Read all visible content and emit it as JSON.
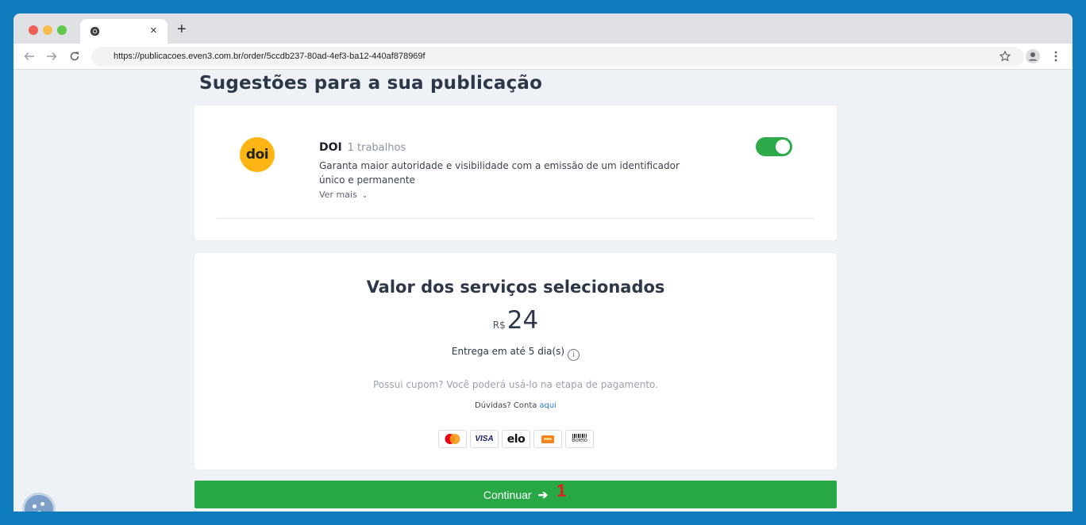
{
  "browser": {
    "tab_close": "×",
    "new_tab": "+",
    "url": "https://publicacoes.even3.com.br/order/5ccdb237-80ad-4ef3-ba12-440af878969f"
  },
  "page": {
    "heading": "Sugestões para a sua publicação"
  },
  "suggestion": {
    "logo_text": "doi",
    "title": "DOI",
    "count": "1 trabalhos",
    "description": "Garanta maior autoridade e visibilidade com a emissão de um identificador único e permanente",
    "see_more": "Ver mais",
    "toggle_on": true,
    "toggle_color": "#2eaa4a"
  },
  "summary": {
    "title": "Valor dos serviços selecionados",
    "currency": "R$",
    "price": "24",
    "delivery": "Entrega em até 5 dia(s)",
    "coupon_note": "Possui cupom? Você poderá usá-lo na etapa de pagamento.",
    "doubts_text": "Dúvidas? Conta",
    "doubts_link": "aqui",
    "payment_methods": {
      "visa": "VISA",
      "elo": "elo",
      "boleto": "Boleto"
    }
  },
  "actions": {
    "continue_label": "Continuar",
    "continue_arrow": "➔",
    "continue_color": "#28a745",
    "step_marker": "1"
  }
}
